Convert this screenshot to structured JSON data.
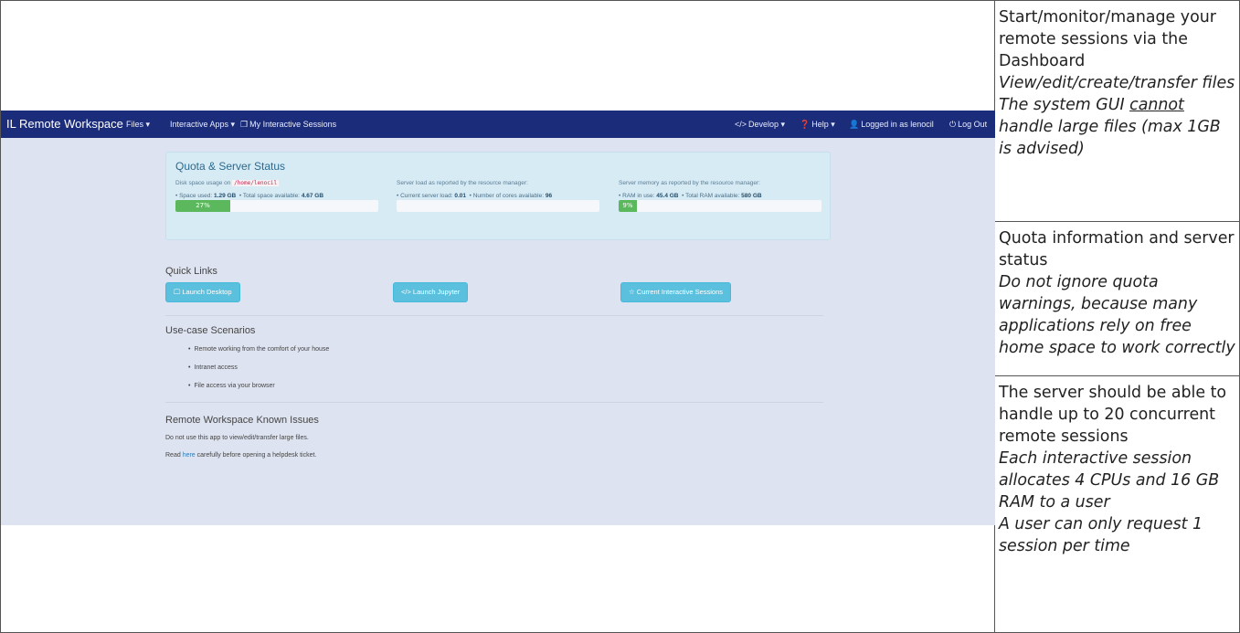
{
  "screenshot": {
    "navbar": {
      "brand": "IL Remote Workspace",
      "left_items": [
        {
          "label": "Files ▾"
        },
        {
          "label": "Interactive Apps ▾"
        },
        {
          "icon": "❐",
          "label": "My Interactive Sessions"
        }
      ],
      "right_items": [
        {
          "icon": "</>",
          "label": "Develop ▾"
        },
        {
          "icon": "❓",
          "label": "Help ▾"
        },
        {
          "icon": "👤",
          "label": "Logged in as lenocil"
        },
        {
          "icon": "⏻",
          "label": "Log Out"
        }
      ]
    },
    "quota": {
      "title": "Quota & Server Status",
      "disk": {
        "caption": "Disk space usage on",
        "path": "/home/lenocil",
        "used_label": "• Space used:",
        "used": "1.29 GB",
        "total_label": "• Total space available:",
        "total": "4.67 GB",
        "percent_text": "27%",
        "fraction": 0.27
      },
      "load": {
        "caption": "Server load as reported by the resource manager:",
        "load_label": "• Current server load:",
        "load": "0.01",
        "cores_label": "• Number of cores available:",
        "cores": "96",
        "percent_text": "",
        "fraction": 0.0
      },
      "memory": {
        "caption": "Server memory as reported by the resource manager:",
        "ram_label": "• RAM in use:",
        "ram": "45.4 GB",
        "total_label": "• Total RAM available:",
        "total": "580 GB",
        "percent_text": "9%",
        "fraction": 0.09
      }
    },
    "quick_links": {
      "title": "Quick Links",
      "desktop": "🖵 Launch Desktop",
      "jupyter": "</> Launch Jupyter",
      "sessions": "☆ Current Interactive Sessions"
    },
    "use_cases": {
      "title": "Use-case Scenarios",
      "items": [
        "Remote working from the comfort of your house",
        "Intranet access",
        "File access via your browser"
      ]
    },
    "issues": {
      "title": "Remote Workspace Known Issues",
      "line1": "Do not use this app to view/edit/transfer large files.",
      "line2_pre": "Read ",
      "line2_link": "here",
      "line2_post": " carefully before opening a helpdesk ticket."
    }
  },
  "notes": {
    "cell1": {
      "text": "Start/monitor/manage your remote sessions via the Dashboard",
      "em1": "View/edit/create/transfer files",
      "em2_pre": "The system GUI ",
      "em2_u": "cannot",
      "em2_post": " handle large files (max 1GB is advised)"
    },
    "cell2": {
      "text": "Quota information and server status",
      "em": "Do not ignore quota warnings, because many applications rely on free home space to work correctly"
    },
    "cell3": {
      "text": "The server should be able to handle up to 20 concurrent remote sessions",
      "em1": "Each interactive session allocates 4 CPUs and 16 GB RAM to a user",
      "em2": "A user can only request 1 session per time"
    }
  }
}
